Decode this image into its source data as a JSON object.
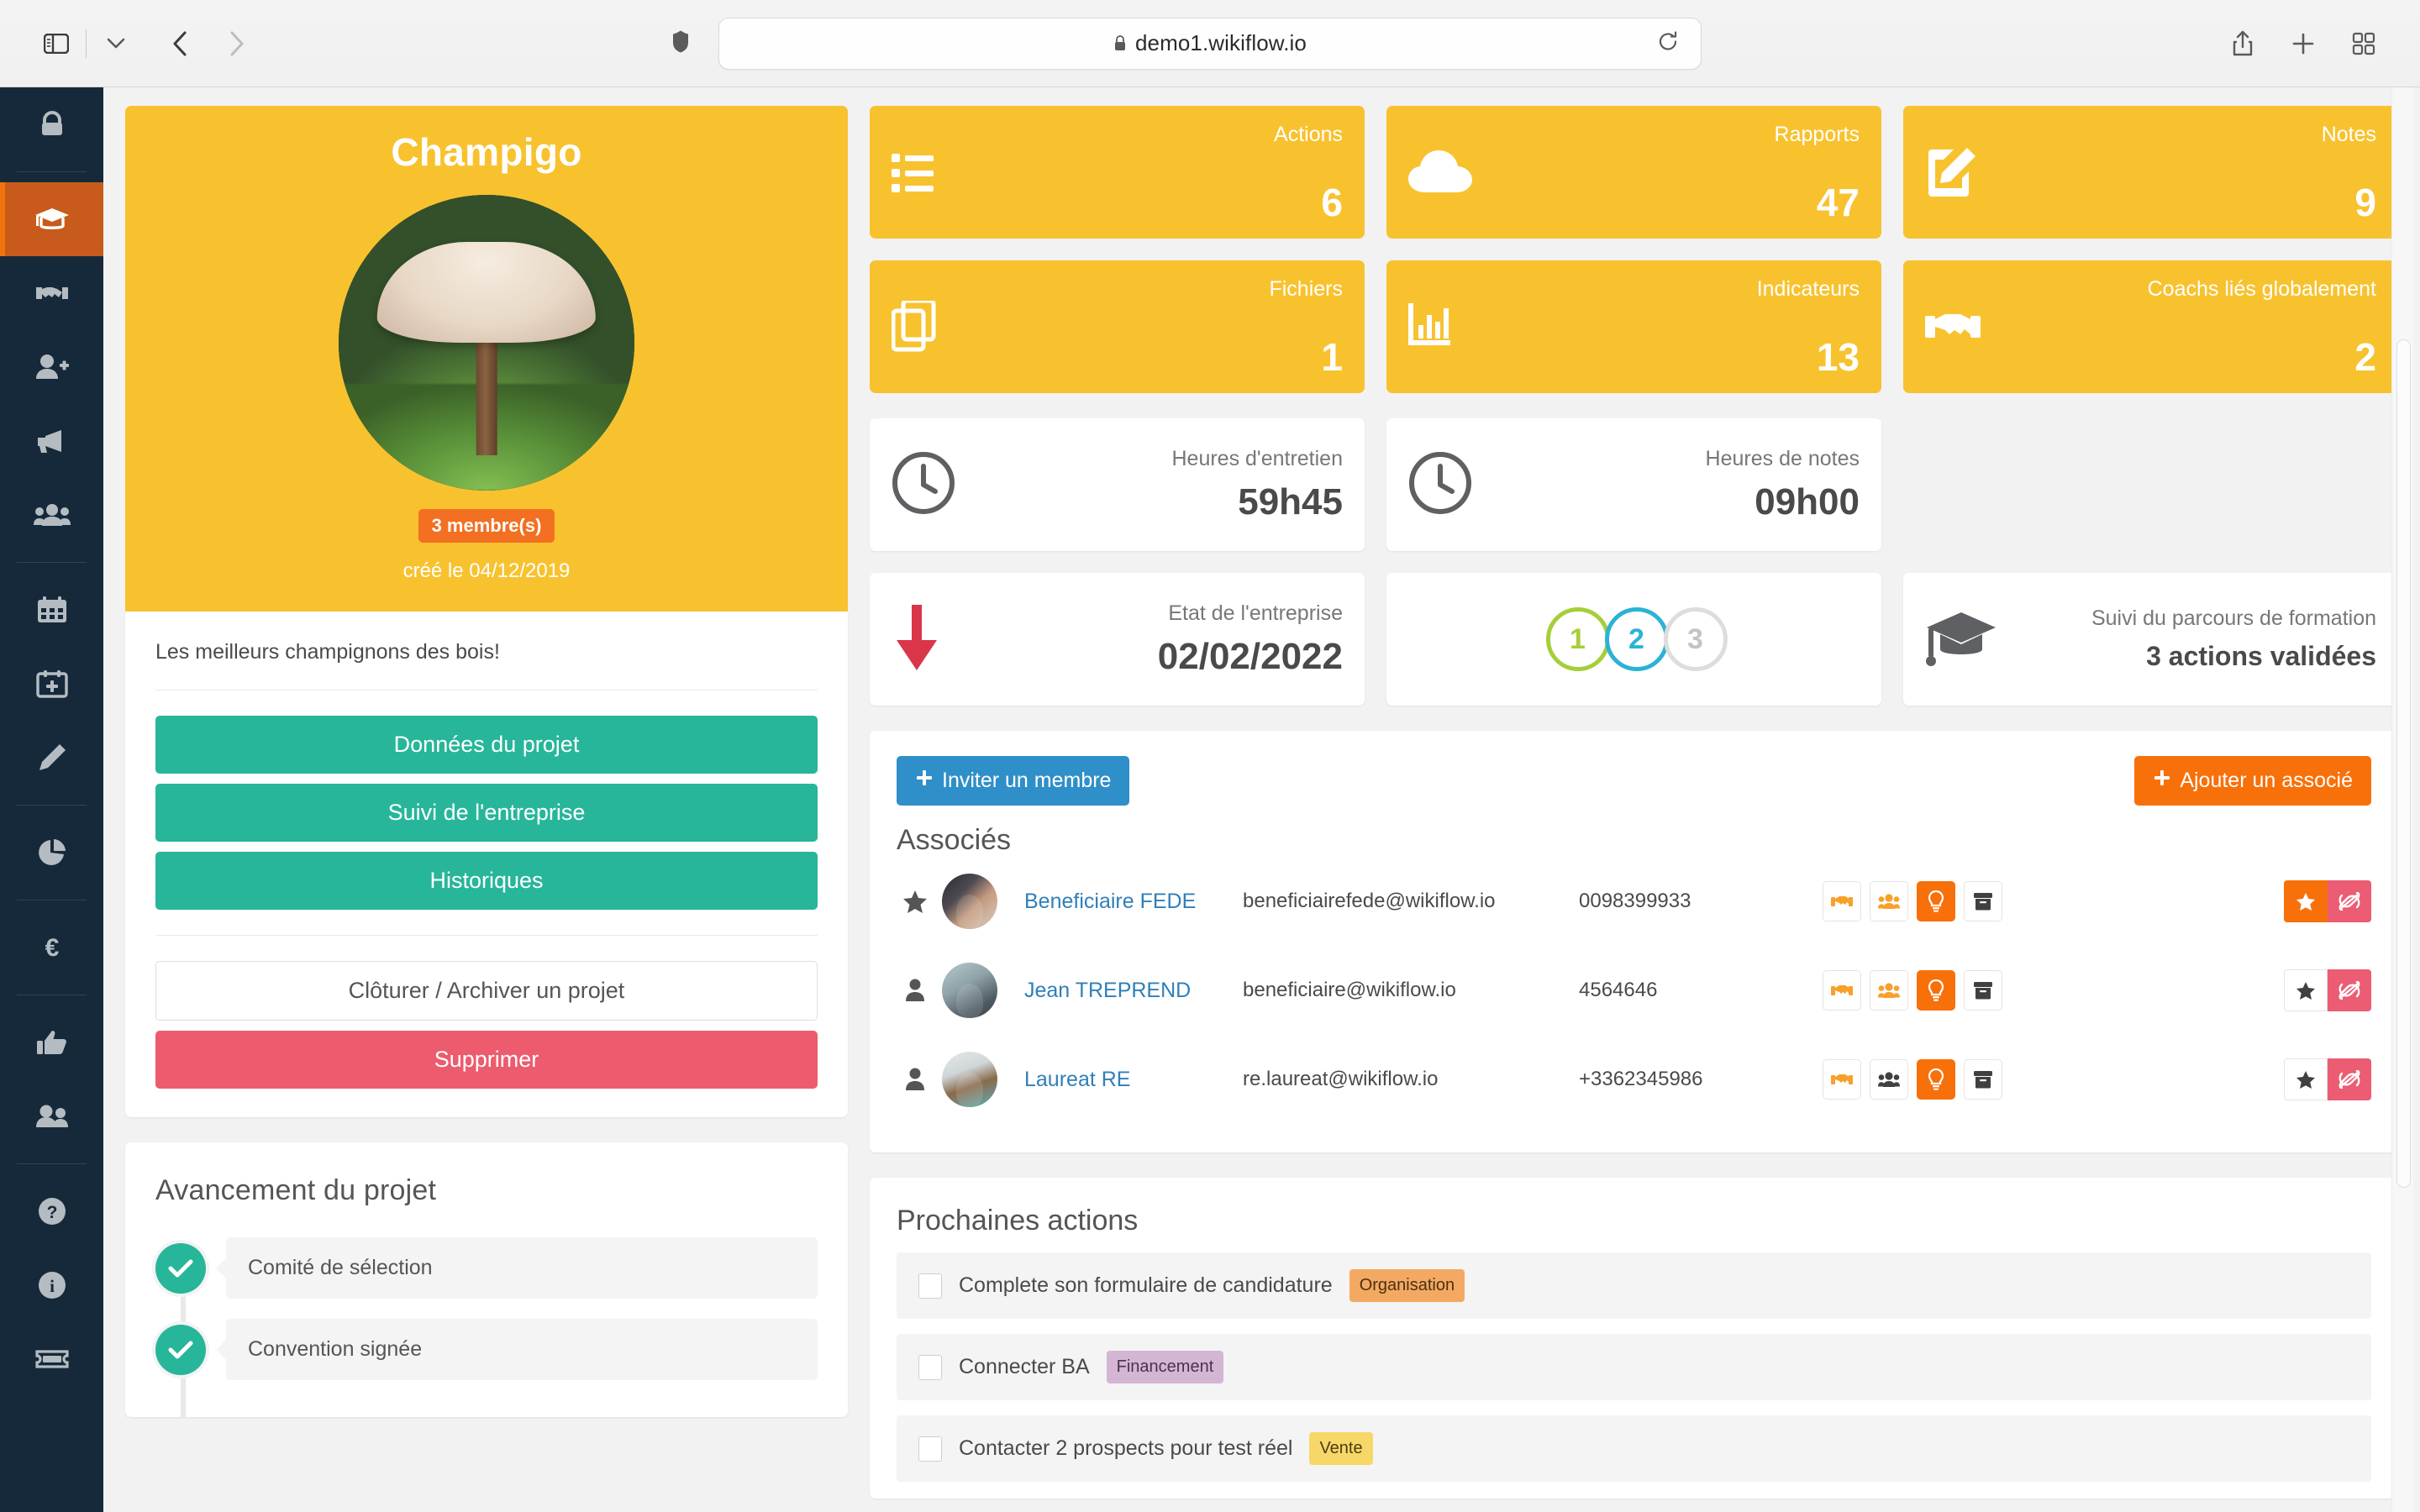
{
  "browser": {
    "url": "demo1.wikiflow.io",
    "icons": {
      "sidebar_toggle": "sidebar-toggle-icon",
      "tab_chevron": "chevron-down-icon",
      "back": "back-arrow-icon",
      "forward": "forward-arrow-icon",
      "shield": "shield-icon",
      "lock": "lock-icon",
      "reload": "reload-icon",
      "share": "share-icon",
      "new_tab": "plus-icon",
      "tab_overview": "tab-overview-icon"
    }
  },
  "sidebar": {
    "items": [
      {
        "name": "lock",
        "label": "Sécurité",
        "active": false
      },
      {
        "name": "graduation-cap",
        "label": "Formation",
        "active": true
      },
      {
        "name": "handshake",
        "label": "Coachs",
        "active": false
      },
      {
        "name": "user-plus",
        "label": "Ajouter un utilisateur",
        "active": false
      },
      {
        "name": "megaphone",
        "label": "Annonces",
        "active": false
      },
      {
        "name": "users",
        "label": "Communauté",
        "active": false
      },
      {
        "name": "calendar",
        "label": "Agenda",
        "active": false
      },
      {
        "name": "calendar-plus",
        "label": "Nouvel événement",
        "active": false
      },
      {
        "name": "pencil",
        "label": "Notes",
        "active": false
      },
      {
        "name": "pie-chart",
        "label": "Statistiques",
        "active": false
      },
      {
        "name": "euro",
        "label": "Financement",
        "active": false
      },
      {
        "name": "thumbs-up",
        "label": "Avis",
        "active": false
      },
      {
        "name": "user-group",
        "label": "Membres",
        "active": false
      },
      {
        "name": "question-circle",
        "label": "Aide",
        "active": false
      },
      {
        "name": "info-circle",
        "label": "Informations",
        "active": false
      },
      {
        "name": "ticket",
        "label": "Tickets",
        "active": false
      }
    ]
  },
  "project": {
    "title": "Champigo",
    "avatar_alt": "mushroom-photo",
    "members_badge": "3 membre(s)",
    "created": "créé le 04/12/2019",
    "description": "Les meilleurs champignons des bois!",
    "buttons": [
      {
        "label": "Données du projet",
        "style": "teal"
      },
      {
        "label": "Suivi de l'entreprise",
        "style": "teal"
      },
      {
        "label": "Historiques",
        "style": "teal"
      }
    ],
    "archive_label": "Clôturer / Archiver un projet",
    "delete_label": "Supprimer"
  },
  "avancement": {
    "title": "Avancement du projet",
    "steps": [
      {
        "label": "Comité de sélection",
        "done": true
      },
      {
        "label": "Convention signée",
        "done": true
      }
    ]
  },
  "tiles": [
    {
      "label": "Actions",
      "value": "6",
      "icon": "list-icon"
    },
    {
      "label": "Rapports",
      "value": "47",
      "icon": "cloud-icon"
    },
    {
      "label": "Notes",
      "value": "9",
      "icon": "edit-pencil-icon"
    },
    {
      "label": "Fichiers",
      "value": "1",
      "icon": "copy-files-icon"
    },
    {
      "label": "Indicateurs",
      "value": "13",
      "icon": "bar-chart-icon"
    },
    {
      "label": "Coachs liés globalement",
      "value": "2",
      "icon": "handshake-icon"
    }
  ],
  "white_tiles": {
    "heures_entretien": {
      "label": "Heures d'entretien",
      "value": "59h45",
      "icon": "clock-icon"
    },
    "heures_notes": {
      "label": "Heures de notes",
      "value": "09h00",
      "icon": "clock-icon"
    },
    "etat_entreprise": {
      "label": "Etat de l'entreprise",
      "value": "02/02/2022",
      "icon": "down-arrow-icon"
    },
    "stepper": {
      "circles": [
        {
          "num": "1",
          "color": "#a6ce39"
        },
        {
          "num": "2",
          "color": "#2bb3d6"
        },
        {
          "num": "3",
          "color": "#dddddd"
        }
      ]
    },
    "parcours": {
      "label": "Suivi du parcours de formation",
      "value": "3 actions validées",
      "icon": "graduation-cap-icon"
    }
  },
  "associes": {
    "invite_label": "Inviter un membre",
    "add_label": "Ajouter un associé",
    "title": "Associés",
    "rows": [
      {
        "flag": "star-icon",
        "avatar": "avatar-woman-laptop",
        "name": "Beneficiaire FEDE",
        "email": "beneficiairefede@wikiflow.io",
        "phone": "0098399933",
        "actions": [
          "handshake-icon",
          "users-icon",
          "lightbulb-icon",
          "archive-icon"
        ],
        "right_actions": [
          "star-icon",
          "unlink-icon"
        ],
        "star_active": true
      },
      {
        "flag": "person-icon",
        "avatar": "avatar-man-suit",
        "name": "Jean TREPREND",
        "email": "beneficiaire@wikiflow.io",
        "phone": "4564646",
        "actions": [
          "handshake-icon",
          "users-icon",
          "lightbulb-icon",
          "archive-icon"
        ],
        "right_actions": [
          "star-icon",
          "unlink-icon"
        ],
        "star_active": false
      },
      {
        "flag": "person-icon",
        "avatar": "avatar-man-glasses",
        "name": "Laureat RE",
        "email": "re.laureat@wikiflow.io",
        "phone": "+3362345986",
        "actions": [
          "handshake-icon",
          "users-icon",
          "lightbulb-icon",
          "archive-icon"
        ],
        "right_actions": [
          "star-icon",
          "unlink-icon"
        ],
        "star_active": false
      }
    ]
  },
  "prochaines_actions": {
    "title": "Prochaines actions",
    "rows": [
      {
        "text": "Complete son formulaire de candidature",
        "tag": "Organisation",
        "tag_style": "organisation",
        "checked": false
      },
      {
        "text": "Connecter BA",
        "tag": "Financement",
        "tag_style": "financement",
        "checked": false
      },
      {
        "text": "Contacter 2 prospects pour test réel",
        "tag": "Vente",
        "tag_style": "vente",
        "checked": false
      }
    ]
  },
  "colors": {
    "brand_yellow": "#f8c22f",
    "brand_orange": "#f8700a",
    "teal": "#27b69a",
    "danger": "#ec5c6e",
    "blue": "#2f8fc9",
    "sidebar_dark": "#16293a",
    "active_rail": "#c85a1c"
  }
}
